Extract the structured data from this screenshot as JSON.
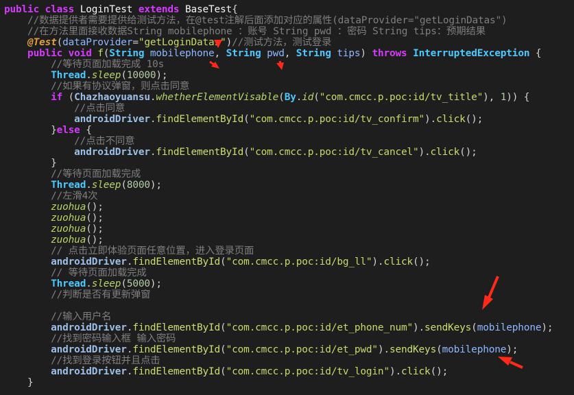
{
  "editor": {
    "lines": [
      [
        {
          "c": "kw",
          "t": "public class "
        },
        {
          "c": "cls",
          "t": "LoginTest "
        },
        {
          "c": "kw",
          "t": "extends "
        },
        {
          "c": "cls",
          "t": "BaseTest"
        },
        {
          "c": "pl",
          "t": "{"
        }
      ],
      [
        {
          "c": "cm",
          "t": "    //数据提供者需要提供给测试方法，在@test注解后面添加对应的属性(dataProvider=\"getLoginDatas\")"
        }
      ],
      [
        {
          "c": "cm",
          "t": "    //在方法里面接收数据String mobilephone ：账号 String pwd ：密码 String tips：预期结果"
        }
      ],
      [
        {
          "c": "ann",
          "t": "    @Test"
        },
        {
          "c": "pl",
          "t": "("
        },
        {
          "c": "var",
          "t": "dataProvider"
        },
        {
          "c": "pl",
          "t": "="
        },
        {
          "c": "str",
          "t": "\"getLoginDatas\""
        },
        {
          "c": "pl",
          "t": ")"
        },
        {
          "c": "cm",
          "t": "//测试方法，测试登录"
        }
      ],
      [
        {
          "c": "kw",
          "t": "    public void "
        },
        {
          "c": "m",
          "t": "f"
        },
        {
          "c": "pl",
          "t": "("
        },
        {
          "c": "type",
          "t": "String "
        },
        {
          "c": "var",
          "t": "mobilephone"
        },
        {
          "c": "pl",
          "t": ", "
        },
        {
          "c": "type",
          "t": "String "
        },
        {
          "c": "var",
          "t": "pwd"
        },
        {
          "c": "pl",
          "t": ", "
        },
        {
          "c": "type",
          "t": "String "
        },
        {
          "c": "var",
          "t": "tips"
        },
        {
          "c": "pl",
          "t": ") "
        },
        {
          "c": "kw",
          "t": "throws "
        },
        {
          "c": "type",
          "t": "InterruptedException"
        },
        {
          "c": "pl",
          "t": " {"
        }
      ],
      [
        {
          "c": "cm",
          "t": "        //等待页面加载完成 10s"
        }
      ],
      [
        {
          "c": "pl",
          "t": "        "
        },
        {
          "c": "type",
          "t": "Thread"
        },
        {
          "c": "pl",
          "t": "."
        },
        {
          "c": "sm",
          "t": "sleep"
        },
        {
          "c": "pl",
          "t": "("
        },
        {
          "c": "num",
          "t": "10000"
        },
        {
          "c": "pl",
          "t": ");"
        }
      ],
      [
        {
          "c": "cm",
          "t": "        //如果有协议弹窗，则点击同意"
        }
      ],
      [
        {
          "c": "kw",
          "t": "        if "
        },
        {
          "c": "pl",
          "t": "("
        },
        {
          "c": "drv",
          "t": "Chazhaoyuansu"
        },
        {
          "c": "pl",
          "t": "."
        },
        {
          "c": "sm",
          "t": "whetherElementVisable"
        },
        {
          "c": "pl",
          "t": "("
        },
        {
          "c": "type",
          "t": "By"
        },
        {
          "c": "pl",
          "t": "."
        },
        {
          "c": "sm",
          "t": "id"
        },
        {
          "c": "pl",
          "t": "("
        },
        {
          "c": "str",
          "t": "\"com.cmcc.p.poc:id/tv_title\""
        },
        {
          "c": "pl",
          "t": "), "
        },
        {
          "c": "num",
          "t": "1"
        },
        {
          "c": "pl",
          "t": ")) {"
        }
      ],
      [
        {
          "c": "cm",
          "t": "            //点击同意"
        }
      ],
      [
        {
          "c": "pl",
          "t": "            "
        },
        {
          "c": "drv",
          "t": "androidDriver"
        },
        {
          "c": "pl",
          "t": "."
        },
        {
          "c": "m",
          "t": "findElementById"
        },
        {
          "c": "pl",
          "t": "("
        },
        {
          "c": "str",
          "t": "\"com.cmcc.p.poc:id/tv_confirm\""
        },
        {
          "c": "pl",
          "t": ")."
        },
        {
          "c": "m",
          "t": "click"
        },
        {
          "c": "pl",
          "t": "();"
        }
      ],
      [
        {
          "c": "pl",
          "t": "        }"
        },
        {
          "c": "kw",
          "t": "else "
        },
        {
          "c": "pl",
          "t": "{"
        }
      ],
      [
        {
          "c": "cm",
          "t": "            //点击不同意"
        }
      ],
      [
        {
          "c": "pl",
          "t": "            "
        },
        {
          "c": "drv",
          "t": "androidDriver"
        },
        {
          "c": "pl",
          "t": "."
        },
        {
          "c": "m",
          "t": "findElementById"
        },
        {
          "c": "pl",
          "t": "("
        },
        {
          "c": "str",
          "t": "\"com.cmcc.p.poc:id/tv_cancel\""
        },
        {
          "c": "pl",
          "t": ")."
        },
        {
          "c": "m",
          "t": "click"
        },
        {
          "c": "pl",
          "t": "();"
        }
      ],
      [
        {
          "c": "pl",
          "t": "        }"
        }
      ],
      [
        {
          "c": "cm",
          "t": "        //等待页面加载完成"
        }
      ],
      [
        {
          "c": "pl",
          "t": "        "
        },
        {
          "c": "type",
          "t": "Thread"
        },
        {
          "c": "pl",
          "t": "."
        },
        {
          "c": "sm",
          "t": "sleep"
        },
        {
          "c": "pl",
          "t": "("
        },
        {
          "c": "num",
          "t": "8000"
        },
        {
          "c": "pl",
          "t": ");"
        }
      ],
      [
        {
          "c": "cm",
          "t": "        //左滑4次"
        }
      ],
      [
        {
          "c": "pl",
          "t": "        "
        },
        {
          "c": "sm",
          "t": "zuohua"
        },
        {
          "c": "pl",
          "t": "();"
        }
      ],
      [
        {
          "c": "pl",
          "t": "        "
        },
        {
          "c": "sm",
          "t": "zuohua"
        },
        {
          "c": "pl",
          "t": "();"
        }
      ],
      [
        {
          "c": "pl",
          "t": "        "
        },
        {
          "c": "sm",
          "t": "zuohua"
        },
        {
          "c": "pl",
          "t": "();"
        }
      ],
      [
        {
          "c": "pl",
          "t": "        "
        },
        {
          "c": "sm",
          "t": "zuohua"
        },
        {
          "c": "pl",
          "t": "();"
        }
      ],
      [
        {
          "c": "cm",
          "t": "        // 点击立即体验页面任意位置，进入登录页面"
        }
      ],
      [
        {
          "c": "pl",
          "t": "        "
        },
        {
          "c": "drv",
          "t": "androidDriver"
        },
        {
          "c": "pl",
          "t": "."
        },
        {
          "c": "m",
          "t": "findElementById"
        },
        {
          "c": "pl",
          "t": "("
        },
        {
          "c": "str",
          "t": "\"com.cmcc.p.poc:id/bg_ll\""
        },
        {
          "c": "pl",
          "t": ")."
        },
        {
          "c": "m",
          "t": "click"
        },
        {
          "c": "pl",
          "t": "();"
        }
      ],
      [
        {
          "c": "cm",
          "t": "        // 等待页面加载完成"
        }
      ],
      [
        {
          "c": "pl",
          "t": "        "
        },
        {
          "c": "type",
          "t": "Thread"
        },
        {
          "c": "pl",
          "t": "."
        },
        {
          "c": "sm",
          "t": "sleep"
        },
        {
          "c": "pl",
          "t": "("
        },
        {
          "c": "num",
          "t": "5000"
        },
        {
          "c": "pl",
          "t": ");"
        }
      ],
      [
        {
          "c": "cm",
          "t": "        //判断是否有更新弹窗"
        }
      ],
      [
        {
          "c": "pl",
          "t": " "
        }
      ],
      [
        {
          "c": "cm",
          "t": "        //输入用户名"
        }
      ],
      [
        {
          "c": "pl",
          "t": "        "
        },
        {
          "c": "drv",
          "t": "androidDriver"
        },
        {
          "c": "pl",
          "t": "."
        },
        {
          "c": "m",
          "t": "findElementById"
        },
        {
          "c": "pl",
          "t": "("
        },
        {
          "c": "str",
          "t": "\"com.cmcc.p.poc:id/et_phone_num\""
        },
        {
          "c": "pl",
          "t": ")."
        },
        {
          "c": "m",
          "t": "sendKeys"
        },
        {
          "c": "pl",
          "t": "("
        },
        {
          "c": "var",
          "t": "mobilephone"
        },
        {
          "c": "pl",
          "t": ");"
        }
      ],
      [
        {
          "c": "cm",
          "t": "        //找到密码输入框 输入密码"
        }
      ],
      [
        {
          "c": "pl",
          "t": "        "
        },
        {
          "c": "drv",
          "t": "androidDriver"
        },
        {
          "c": "pl",
          "t": "."
        },
        {
          "c": "m",
          "t": "findElementById"
        },
        {
          "c": "pl",
          "t": "("
        },
        {
          "c": "str",
          "t": "\"com.cmcc.p.poc:id/et_pwd\""
        },
        {
          "c": "pl",
          "t": ")."
        },
        {
          "c": "m",
          "t": "sendKeys"
        },
        {
          "c": "pl",
          "t": "("
        },
        {
          "c": "var",
          "t": "mobilephone"
        },
        {
          "c": "pl",
          "t": ");"
        }
      ],
      [
        {
          "c": "cm",
          "t": "        //找到登录按钮并且点击"
        }
      ],
      [
        {
          "c": "pl",
          "t": "        "
        },
        {
          "c": "drv",
          "t": "androidDriver"
        },
        {
          "c": "pl",
          "t": "."
        },
        {
          "c": "m",
          "t": "findElementById"
        },
        {
          "c": "pl",
          "t": "("
        },
        {
          "c": "str",
          "t": "\"com.cmcc.p.poc:id/tv_login\""
        },
        {
          "c": "pl",
          "t": ")."
        },
        {
          "c": "m",
          "t": "click"
        },
        {
          "c": "pl",
          "t": "();"
        }
      ],
      [
        {
          "c": "pl",
          "t": "    }"
        }
      ]
    ]
  },
  "colors": {
    "background": "#1e1e1e",
    "keyword": "#d63aff",
    "type": "#4ec9ff",
    "comment": "#7f7f7f",
    "string": "#c9d96a",
    "arrow": "#ff2a1a"
  },
  "annotations": [
    {
      "name": "red-arrow-icon",
      "points_at": "dataProvider value"
    },
    {
      "name": "red-arrow-icon",
      "points_at": "mobilephone parameter"
    },
    {
      "name": "red-arrow-icon",
      "points_at": "pwd parameter"
    },
    {
      "name": "red-arrow-icon",
      "points_at": "mobilephone in username sendKeys"
    },
    {
      "name": "red-arrow-icon",
      "points_at": "mobilephone in password sendKeys"
    }
  ]
}
